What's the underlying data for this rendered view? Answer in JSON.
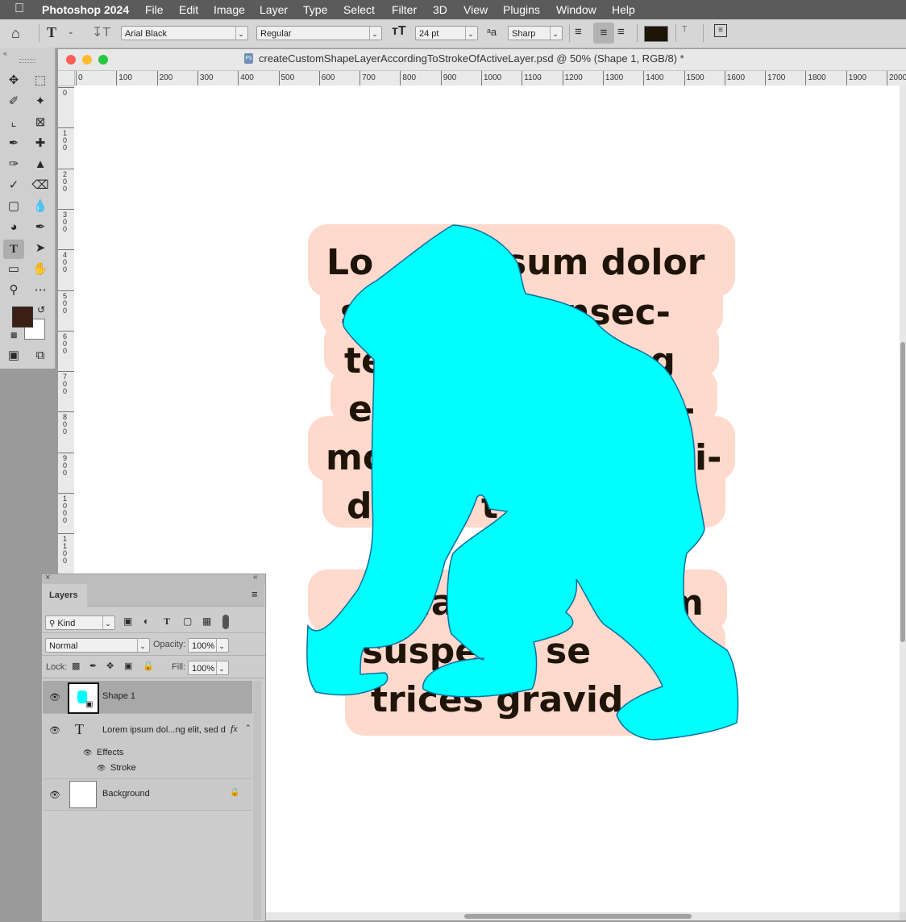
{
  "menubar": {
    "app_name": "Photoshop 2024",
    "items": [
      "File",
      "Edit",
      "Image",
      "Layer",
      "Type",
      "Select",
      "Filter",
      "3D",
      "View",
      "Plugins",
      "Window",
      "Help"
    ]
  },
  "options": {
    "font_family": "Arial Black",
    "font_style": "Regular",
    "font_size": "24 pt",
    "antialias": "Sharp",
    "text_color": "#1f1408"
  },
  "document": {
    "title": "createCustomShapeLayerAccordingToStrokeOfActiveLayer.psd @ 50% (Shape 1, RGB/8) *",
    "ruler_h_labels": [
      "0",
      "100",
      "200",
      "300",
      "400",
      "500",
      "600",
      "700",
      "800",
      "900",
      "1000",
      "1100",
      "1200",
      "1300",
      "1400",
      "1500",
      "1600",
      "1700",
      "1800",
      "1900",
      "2000"
    ],
    "ruler_v_labels": [
      "0",
      "100",
      "200",
      "300",
      "400",
      "500",
      "600",
      "700",
      "800",
      "900",
      "1000",
      "1100"
    ],
    "text_lines": [
      {
        "a": "Lo",
        "b": "sum dolor"
      },
      {
        "a": "s",
        "b": "onsec-"
      },
      {
        "a": "te",
        "b": "ing"
      },
      {
        "a": "e",
        "b": "-"
      },
      {
        "a": "mo",
        "b": "i-"
      },
      {
        "a": "d",
        "b": "t"
      },
      {
        "a": "",
        "b": ""
      },
      {
        "a": "qua",
        "b": "m"
      },
      {
        "a": "suspe",
        "b": "se"
      },
      {
        "a": "trices gravid",
        "b": ""
      }
    ],
    "shape_color": "#00ffff",
    "stroke_color": "#ffd9cc"
  },
  "layers": {
    "title": "Layers",
    "filter_kind": "Kind",
    "blend_mode": "Normal",
    "opacity_label": "Opacity:",
    "opacity_value": "100%",
    "lock_label": "Lock:",
    "fill_label": "Fill:",
    "fill_value": "100%",
    "rows": {
      "shape": "Shape 1",
      "text": "Lorem ipsum dol...ng elit, sed d",
      "effects": "Effects",
      "stroke": "Stroke",
      "background": "Background"
    }
  },
  "colors": {
    "foreground": "#3b1f15",
    "background": "#ffffff"
  }
}
